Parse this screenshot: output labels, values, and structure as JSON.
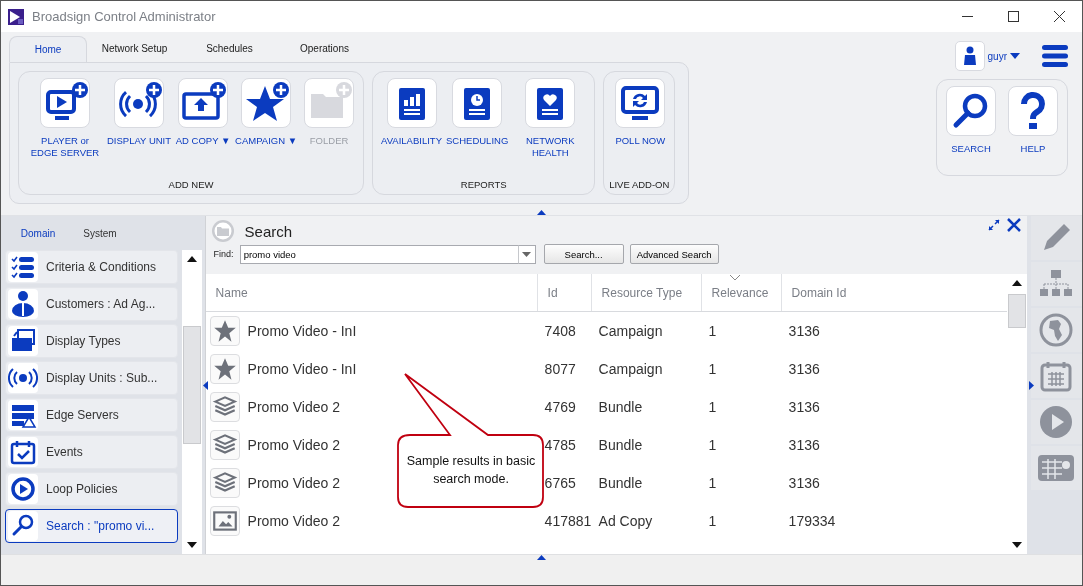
{
  "window": {
    "title": "Broadsign Control Administrator"
  },
  "ribbon": {
    "tabs": [
      {
        "label": "Home",
        "selected": true
      },
      {
        "label": "Network Setup",
        "selected": false
      },
      {
        "label": "Schedules",
        "selected": false
      },
      {
        "label": "Operations",
        "selected": false
      }
    ],
    "groups": [
      {
        "label": "ADD NEW",
        "buttons": [
          {
            "kind": "player",
            "label": "PLAYER or EDGE SERVER",
            "disabled": false
          },
          {
            "kind": "display",
            "label": "DISPLAY UNIT",
            "disabled": false
          },
          {
            "kind": "adcopy",
            "label": "AD COPY ▼",
            "disabled": false
          },
          {
            "kind": "campaign",
            "label": "CAMPAIGN ▼",
            "disabled": false
          },
          {
            "kind": "folder",
            "label": "FOLDER",
            "disabled": true
          }
        ]
      },
      {
        "label": "REPORTS",
        "buttons": [
          {
            "kind": "availability",
            "label": "AVAILABILITY",
            "disabled": false
          },
          {
            "kind": "scheduling",
            "label": "SCHEDULING",
            "disabled": false
          },
          {
            "kind": "health",
            "label": "NETWORK HEALTH",
            "disabled": false
          }
        ]
      },
      {
        "label": "LIVE ADD-ON",
        "buttons": [
          {
            "kind": "poll",
            "label": "POLL NOW",
            "disabled": false
          }
        ]
      }
    ],
    "user": "guyr",
    "tools": [
      {
        "kind": "search",
        "label": "SEARCH"
      },
      {
        "kind": "help",
        "label": "HELP"
      }
    ]
  },
  "sidebar": {
    "tabs": [
      {
        "label": "Domain",
        "selected": true
      },
      {
        "label": "System",
        "selected": false
      }
    ],
    "items": [
      {
        "kind": "criteria",
        "label": "Criteria & Conditions",
        "selected": false
      },
      {
        "kind": "customers",
        "label": "Customers : Ad Ag...",
        "selected": false
      },
      {
        "kind": "display_types",
        "label": "Display Types",
        "selected": false
      },
      {
        "kind": "display_units",
        "label": "Display Units : Sub...",
        "selected": false
      },
      {
        "kind": "edge",
        "label": "Edge Servers",
        "selected": false
      },
      {
        "kind": "events",
        "label": "Events",
        "selected": false
      },
      {
        "kind": "loop",
        "label": "Loop Policies",
        "selected": false
      },
      {
        "kind": "search",
        "label": "Search : \"promo vi...",
        "selected": true
      }
    ]
  },
  "search": {
    "title": "Search",
    "find_label": "Find:",
    "find_value": "promo video",
    "search_button": "Search...",
    "advanced_button": "Advanced Search",
    "table": {
      "columns": [
        "Name",
        "Id",
        "Resource Type",
        "Relevance",
        "Domain Id"
      ],
      "rows": [
        {
          "kind": "campaign",
          "name": "Promo Video - InI",
          "id": "7408",
          "type": "Campaign",
          "relevance": "1",
          "domain_id": "3136"
        },
        {
          "kind": "campaign",
          "name": "Promo Video - InI",
          "id": "8077",
          "type": "Campaign",
          "relevance": "1",
          "domain_id": "3136"
        },
        {
          "kind": "bundle",
          "name": "Promo Video 2",
          "id": "4769",
          "type": "Bundle",
          "relevance": "1",
          "domain_id": "3136"
        },
        {
          "kind": "bundle",
          "name": "Promo Video 2",
          "id": "4785",
          "type": "Bundle",
          "relevance": "1",
          "domain_id": "3136"
        },
        {
          "kind": "bundle",
          "name": "Promo Video 2",
          "id": "6765",
          "type": "Bundle",
          "relevance": "1",
          "domain_id": "3136"
        },
        {
          "kind": "adcopy",
          "name": "Promo Video 2",
          "id": "417881",
          "type": "Ad Copy",
          "relevance": "1",
          "domain_id": "179334"
        }
      ]
    }
  },
  "callout": {
    "text": "Sample results in basic search mode."
  }
}
